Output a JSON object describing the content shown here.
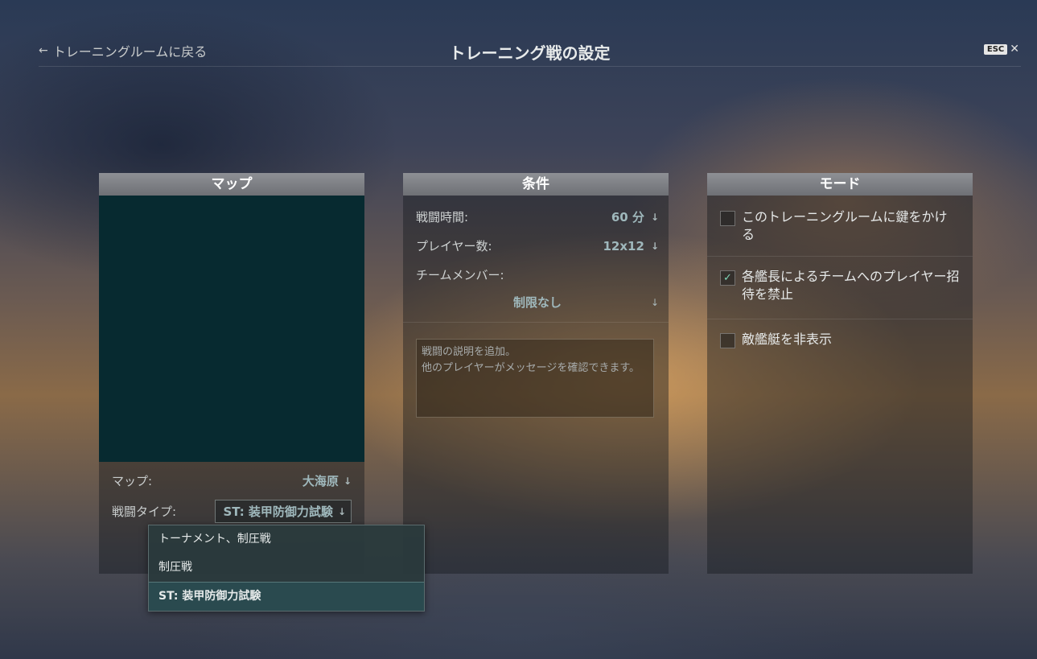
{
  "header": {
    "back_label": "トレーニングルームに戻る",
    "title": "トレーニング戦の設定",
    "esc_label": "ESC",
    "close_symbol": "✕"
  },
  "map_panel": {
    "title": "マップ",
    "map_label": "マップ:",
    "map_value": "大海原",
    "battle_type_label": "戦闘タイプ:",
    "battle_type_value": "ST: 装甲防御力試験",
    "preview_color": "#072a30"
  },
  "battle_type_dropdown": {
    "options": [
      "トーナメント、制圧戦",
      "制圧戦",
      "ST: 装甲防御力試験"
    ],
    "selected_index": 2
  },
  "conditions_panel": {
    "title": "条件",
    "battle_time_label": "戦闘時間:",
    "battle_time_value": "60 分",
    "players_label": "プレイヤー数:",
    "players_value": "12x12",
    "team_members_label": "チームメンバー:",
    "team_members_value": "制限なし",
    "description_placeholder": "戦闘の説明を追加。\n他のプレイヤーがメッセージを確認できます。"
  },
  "mode_panel": {
    "title": "モード",
    "options": [
      {
        "label": "このトレーニングルームに鍵をかける",
        "checked": false
      },
      {
        "label": "各艦長によるチームへのプレイヤー招待を禁止",
        "checked": true
      },
      {
        "label": "敵艦艇を非表示",
        "checked": false
      }
    ]
  },
  "icons": {
    "back": "left-arrow-icon",
    "dropdown": "down-arrow-icon",
    "check": "checkmark-icon"
  },
  "colors": {
    "accent": "#9fb8bc",
    "header_bar": "#7e8085",
    "check": "#7fd6b8"
  }
}
